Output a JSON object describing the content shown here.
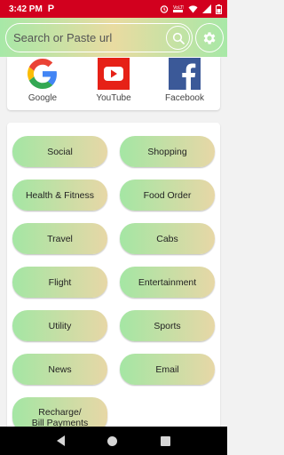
{
  "status_bar": {
    "time": "3:42 PM",
    "app_indicator": "P",
    "icons": [
      "alarm-icon",
      "volte-icon",
      "wifi-icon",
      "signal-icon",
      "battery-icon"
    ],
    "color": "#d2001e"
  },
  "search": {
    "placeholder": "Search or Paste url",
    "search_icon": "search-icon",
    "settings_icon": "gear-icon"
  },
  "shortcuts": [
    {
      "label": "Google",
      "icon": "google-logo"
    },
    {
      "label": "YouTube",
      "icon": "youtube-logo"
    },
    {
      "label": "Facebook",
      "icon": "facebook-logo"
    }
  ],
  "categories": [
    "Social",
    "Shopping",
    "Health & Fitness",
    "Food Order",
    "Travel",
    "Cabs",
    "Flight",
    "Entertainment",
    "Utility",
    "Sports",
    "News",
    "Email",
    "Recharge/\nBill Payments"
  ],
  "colors": {
    "gradient_green": "#a4e6a4",
    "gradient_tan": "#e7d7a6",
    "facebook_blue": "#3b5998",
    "youtube_red": "#e62117"
  },
  "nav_bar": {
    "buttons": [
      "back-icon",
      "home-icon",
      "recents-icon"
    ]
  }
}
